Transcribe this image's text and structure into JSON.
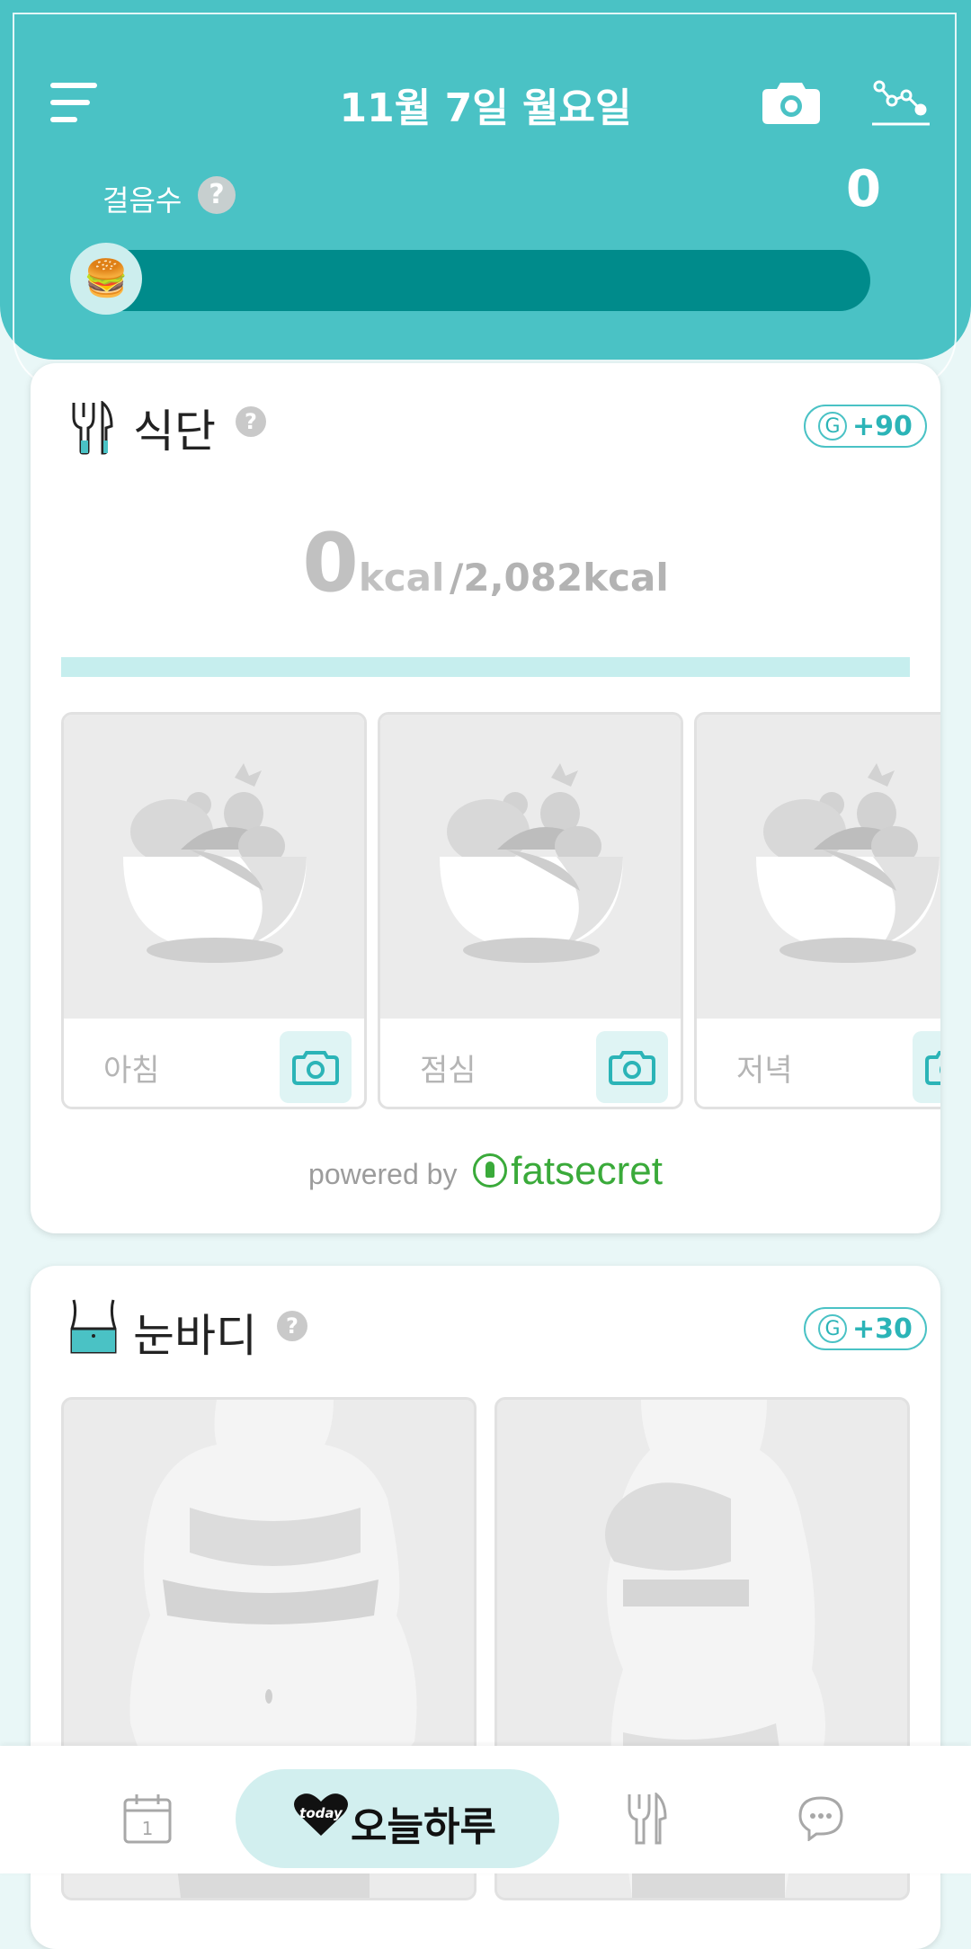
{
  "header": {
    "date": "11월 7일 월요일",
    "steps_label": "걸음수",
    "steps_help": "?",
    "steps_value": "0",
    "progress": 0,
    "progress_icon": "🍔",
    "icons": [
      "menu-icon",
      "camera-icon",
      "graph-icon"
    ]
  },
  "diet": {
    "title": "식단",
    "help": "?",
    "badge_g": "G",
    "badge_points": "+90",
    "kcal_current": "0",
    "kcal_unit": "kcal",
    "kcal_target": "/2,082kcal",
    "meals": [
      {
        "label": "아침"
      },
      {
        "label": "점심"
      },
      {
        "label": "저녁"
      }
    ],
    "powered_by": "powered by",
    "brand": "fatsecret"
  },
  "body": {
    "title": "눈바디",
    "help": "?",
    "badge_g": "G",
    "badge_points": "+30"
  },
  "nav": {
    "today_badge": "today",
    "active_label": "오늘하루",
    "items": [
      "calendar-icon",
      "today-tab",
      "diet-icon",
      "chat-icon"
    ]
  },
  "colors": {
    "primary": "#4ac2c5",
    "progress_track": "#008b8b",
    "background": "#e9f7f7",
    "brand_green": "#3aaa3a"
  }
}
